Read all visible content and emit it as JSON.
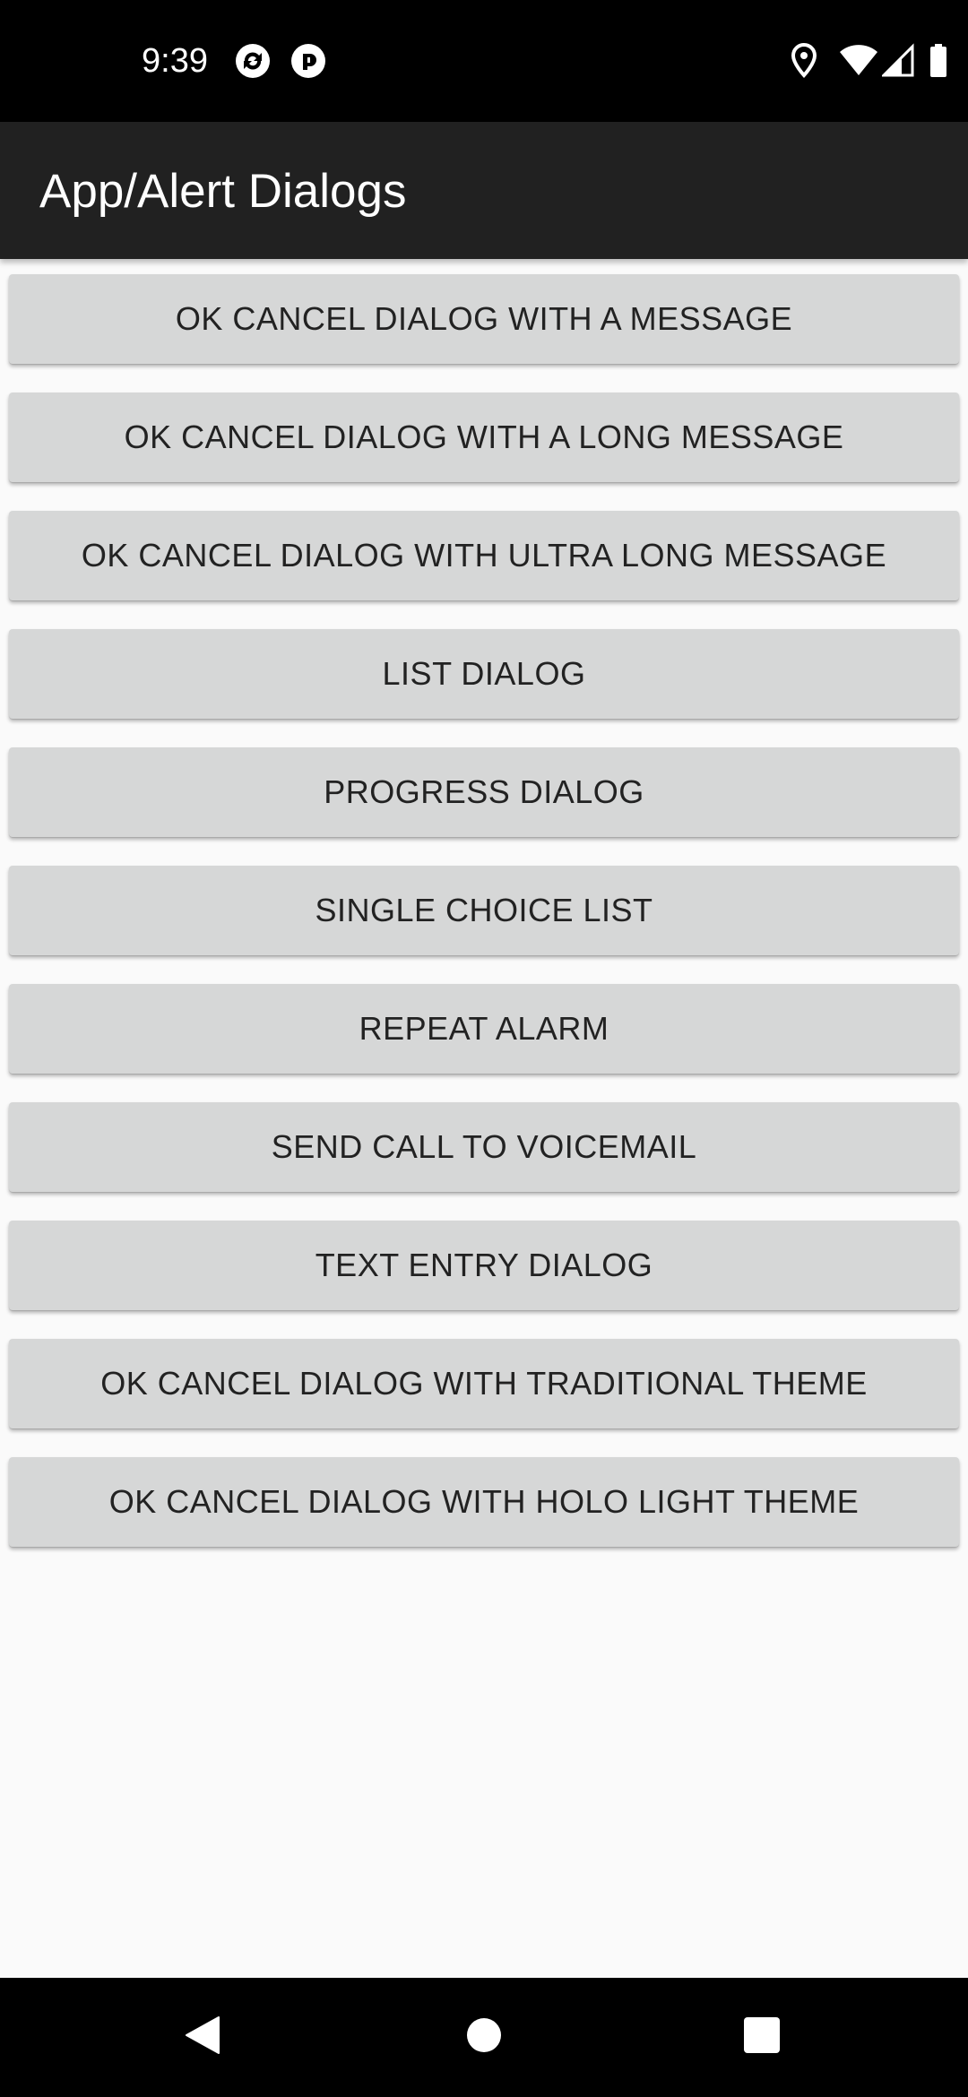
{
  "status_bar": {
    "time": "9:39",
    "left_icons": [
      "sync-app-icon",
      "ring-app-icon"
    ],
    "right_icons": [
      "location-icon",
      "wifi-icon",
      "signal-icon",
      "battery-icon"
    ]
  },
  "app_bar": {
    "title": "App/Alert Dialogs"
  },
  "buttons": [
    {
      "label": "OK CANCEL DIALOG WITH A MESSAGE"
    },
    {
      "label": "OK CANCEL DIALOG WITH A LONG MESSAGE"
    },
    {
      "label": "OK CANCEL DIALOG WITH ULTRA LONG MESSAGE"
    },
    {
      "label": "LIST DIALOG"
    },
    {
      "label": "PROGRESS DIALOG"
    },
    {
      "label": "SINGLE CHOICE LIST"
    },
    {
      "label": "REPEAT ALARM"
    },
    {
      "label": "SEND CALL TO VOICEMAIL"
    },
    {
      "label": "TEXT ENTRY DIALOG"
    },
    {
      "label": "OK CANCEL DIALOG WITH TRADITIONAL THEME"
    },
    {
      "label": "OK CANCEL DIALOG WITH HOLO LIGHT THEME"
    }
  ],
  "nav_bar": {
    "icons": [
      "back-icon",
      "home-icon",
      "recents-icon"
    ]
  },
  "colors": {
    "status_bar_bg": "#000000",
    "app_bar_bg": "#212121",
    "button_bg": "#d6d7d7",
    "content_bg": "#fafafa",
    "button_text": "#222222"
  }
}
